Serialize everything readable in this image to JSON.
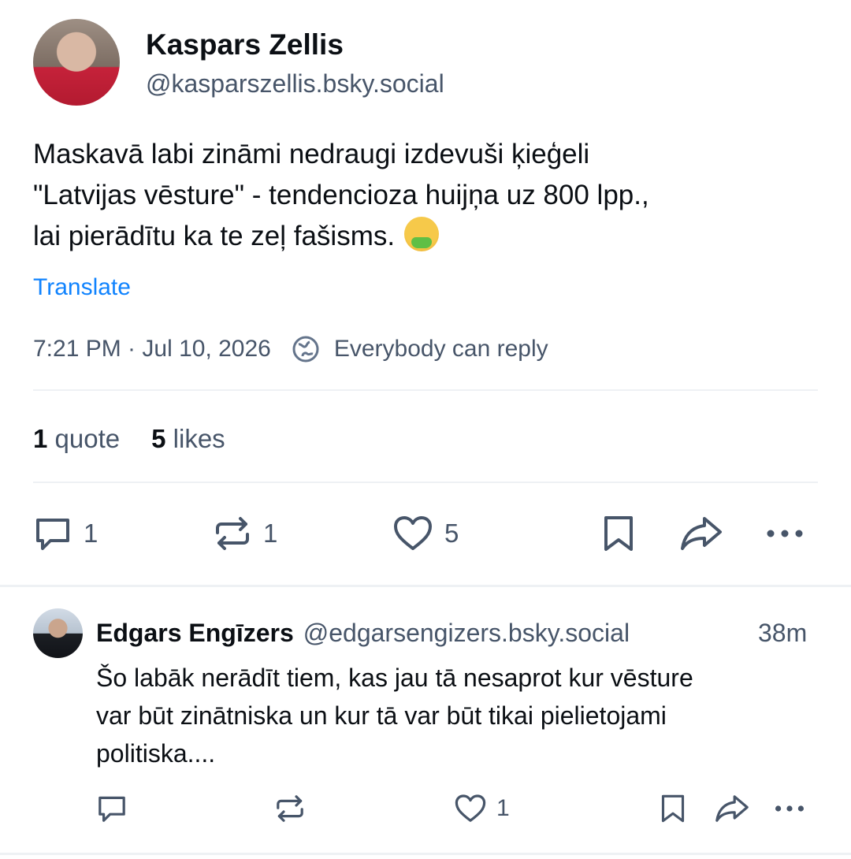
{
  "post": {
    "author_name": "Kaspars Zellis",
    "author_handle": "@kasparszellis.bsky.social",
    "text_lines": [
      "Maskavā labi zināmi nedraugi izdevuši ķieģeli",
      "\"Latvijas vēsture\" - tendencioza huijņa uz 800 lpp.,",
      "lai pierādītu ka te zeļ fašisms."
    ],
    "emoji": "nauseated-face",
    "translate_label": "Translate",
    "timestamp": "7:21 PM · Jul 10, 2026",
    "reply_setting": "Everybody can reply",
    "stats": {
      "quotes_count": "1",
      "quotes_label": "quote",
      "likes_count": "5",
      "likes_label": "likes"
    },
    "actions": {
      "reply_count": "1",
      "repost_count": "1",
      "like_count": "5"
    }
  },
  "reply": {
    "author_name": "Edgars Engīzers",
    "author_handle": "@edgarsengizers.bsky.social",
    "time": "38m",
    "text_lines": [
      "Šo labāk nerādīt tiem, kas jau tā nesaprot kur vēsture",
      "var būt zinātniska un kur tā var būt tikai pielietojami",
      "politiska...."
    ],
    "actions": {
      "like_count": "1"
    }
  },
  "colors": {
    "link": "#1083fe",
    "muted": "#475569",
    "divider": "#eef1f4",
    "text": "#0b0f14"
  }
}
